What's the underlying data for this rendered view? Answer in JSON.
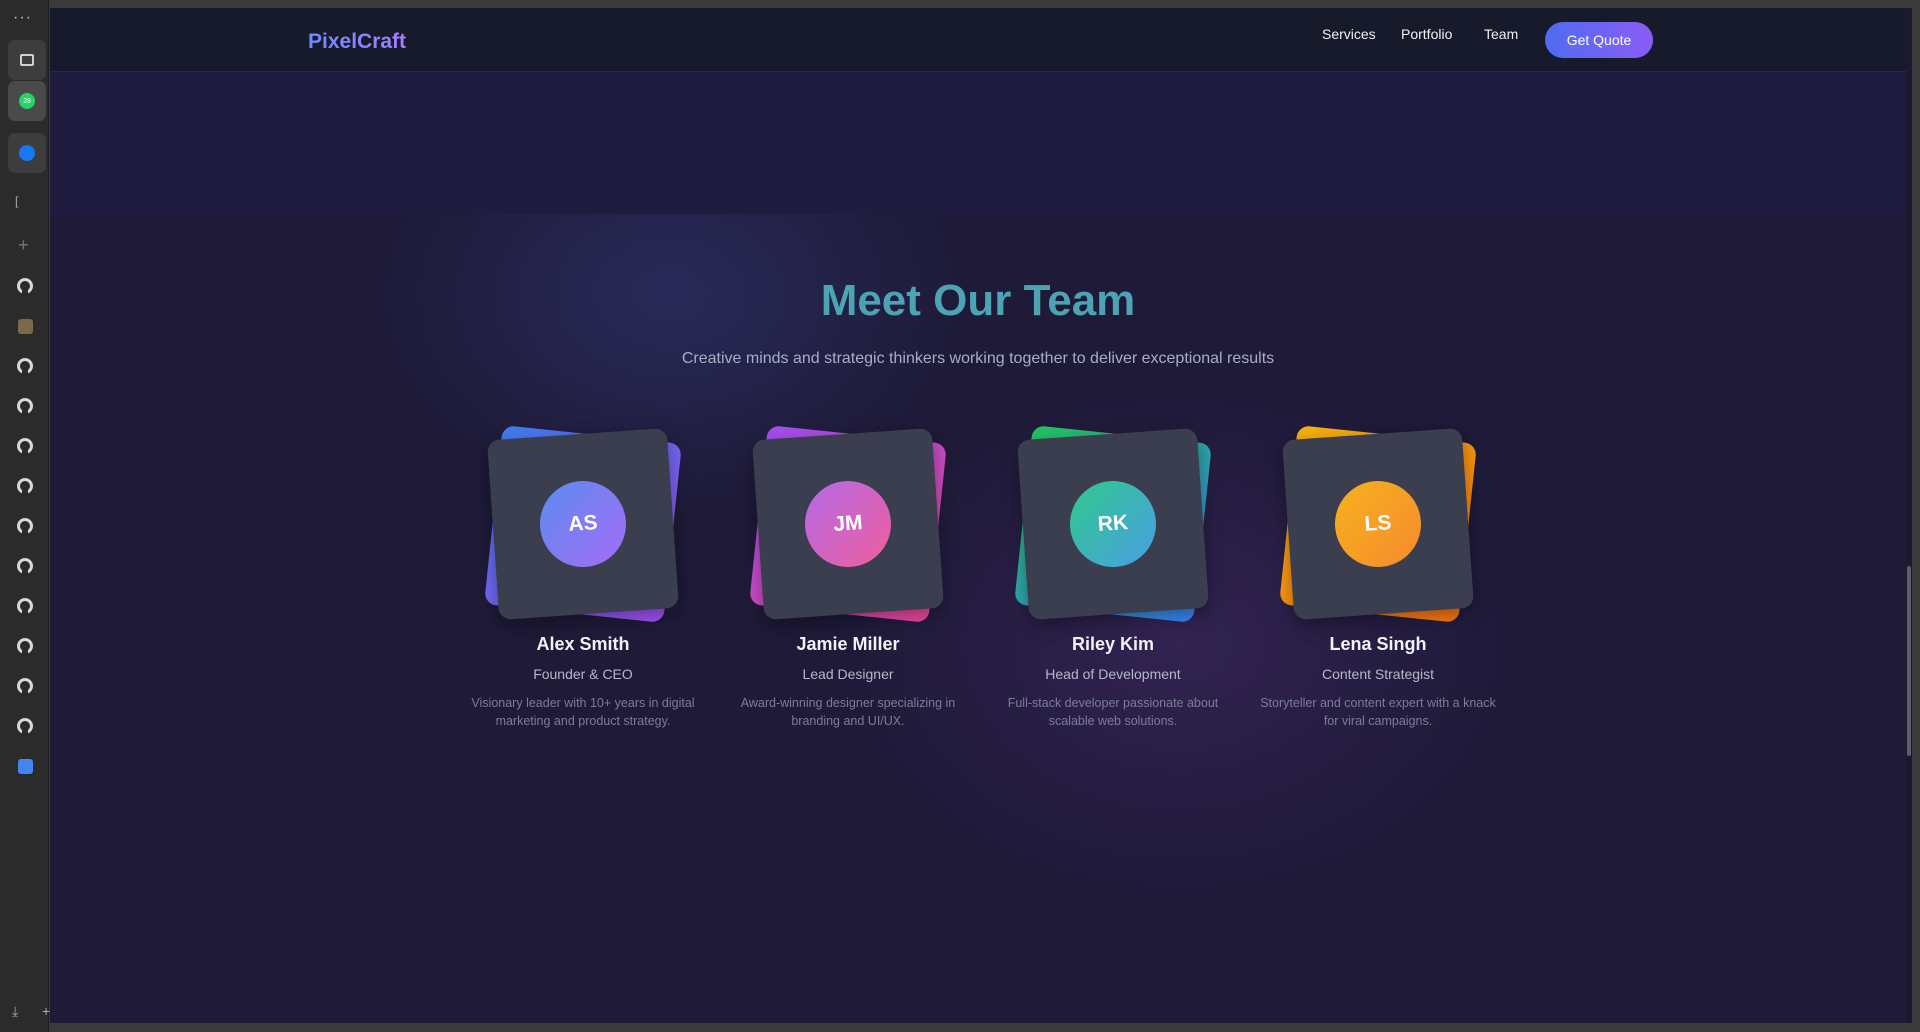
{
  "browser": {
    "rail_dots": "···",
    "rail_bracket": "[",
    "rail_plus": "+",
    "download_glyph": "⤓",
    "add_glyph": "+",
    "tab_badge": "28"
  },
  "nav": {
    "logo": "PixelCraft",
    "links": [
      "Services",
      "Portfolio",
      "Team"
    ],
    "cta": "Get Quote"
  },
  "team": {
    "title": "Meet Our Team",
    "subtitle": "Creative minds and strategic thinkers working together to deliver exceptional results",
    "members": [
      {
        "initials": "AS",
        "name": "Alex Smith",
        "role": "Founder & CEO",
        "bio": "Visionary leader with 10+ years in digital marketing and product strategy.",
        "avatar_from": "#5b8cf0",
        "avatar_to": "#a66cf6",
        "back_from": "#3f7cf0",
        "back_to": "#a34ff2"
      },
      {
        "initials": "JM",
        "name": "Jamie Miller",
        "role": "Lead Designer",
        "bio": "Award-winning designer specializing in branding and UI/UX.",
        "avatar_from": "#b56ae8",
        "avatar_to": "#ee5e9c",
        "back_from": "#a44ef0",
        "back_to": "#ec4899"
      },
      {
        "initials": "RK",
        "name": "Riley Kim",
        "role": "Head of Development",
        "bio": "Full-stack developer passionate about scalable web solutions.",
        "avatar_from": "#2fc98a",
        "avatar_to": "#4a9ee6",
        "back_from": "#22c55e",
        "back_to": "#3b82f6"
      },
      {
        "initials": "LS",
        "name": "Lena Singh",
        "role": "Content Strategist",
        "bio": "Storyteller and content expert with a knack for viral campaigns.",
        "avatar_from": "#f7b21c",
        "avatar_to": "#f58a30",
        "back_from": "#f5b20b",
        "back_to": "#f97316"
      }
    ]
  }
}
